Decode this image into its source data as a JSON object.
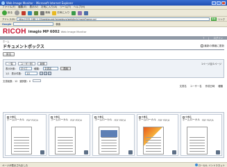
{
  "window": {
    "title": "Web Image Monitor - Microsoft Internet Explorer"
  },
  "menu": [
    "ファイル(F)",
    "編集(E)",
    "表示(V)",
    "お気に入り(A)",
    "ツール(T)",
    "ヘルプ(H)"
  ],
  "toolbar": {
    "back": "戻る",
    "search": "検索",
    "favorites": "お気に入り"
  },
  "address": {
    "label": "アドレス(D)",
    "url": "http://192.168.1.10/web/guest/ja/websys/webArch/mainFrame.cgi",
    "go": "移動",
    "links": "リンク"
  },
  "google": {
    "label": "Google",
    "search_btn": "検索"
  },
  "app": {
    "brand": "RICOH",
    "model": "imagio MP 6002",
    "product": "Web Image Monitor",
    "topbar": [
      "?",
      "|",
      "ログイン"
    ],
    "subhead": "ホーム",
    "page_title": "ドキュメントボックス",
    "right_link": "最新の情報に更新"
  },
  "actions": {
    "back_button": "戻る"
  },
  "filters": {
    "tabs": [
      "一覧",
      "ユーザー別",
      "新規"
    ],
    "right_text": "1ページ目/1ページ",
    "display_label": "表示対象：",
    "display_value": "すべて",
    "format_label": "種類：",
    "format_value": "文書名",
    "apply": "適用",
    "page_label": "1/1",
    "per_page_label": "表示件数：",
    "per_page_value": "10"
  },
  "counts": {
    "label": "文書総数：12",
    "selected_label": "選択数：0"
  },
  "sort": [
    "文書名",
    "ユーザー名",
    "作成日時",
    "種類"
  ],
  "documents": [
    {
      "check_label": "文書名",
      "name": "ホームローカル",
      "meta": "PDF  PDF/A",
      "style": "plain"
    },
    {
      "check_label": "文書名",
      "name": "ホームローカル",
      "meta": "PDF  PDF/A",
      "style": "plain"
    },
    {
      "check_label": "文書名",
      "name": "ホームローカル",
      "meta": "PDF  PDF/A",
      "style": "blue"
    },
    {
      "check_label": "文書名",
      "name": "ホームローカル",
      "meta": "PDF  PDF/A",
      "style": "color"
    },
    {
      "check_label": "文書名",
      "name": "ホームローカル",
      "meta": "PDF  PDF/A",
      "style": "plain"
    }
  ],
  "status": {
    "left": "ページが表示されました",
    "zone": "ローカル イントラネット"
  }
}
